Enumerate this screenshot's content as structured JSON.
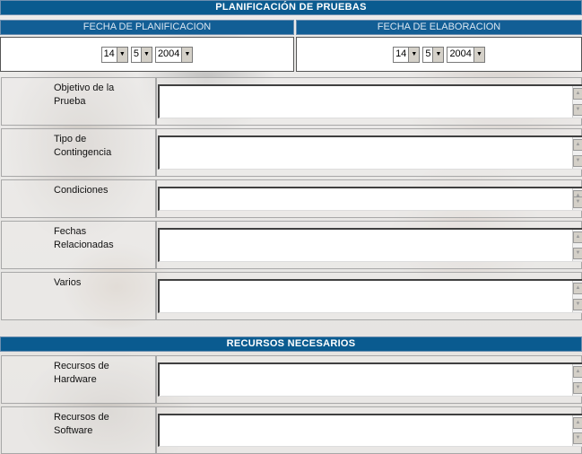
{
  "header": {
    "title": "PLANIFICACIÓN DE PRUEBAS"
  },
  "dates": {
    "planificacion": {
      "label": "FECHA DE PLANIFICACION",
      "day": "14",
      "month": "5",
      "year": "2004"
    },
    "elaboracion": {
      "label": "FECHA DE ELABORACION",
      "day": "14",
      "month": "5",
      "year": "2004"
    }
  },
  "fields": [
    {
      "label": "Objetivo de la\nPrueba",
      "value": ""
    },
    {
      "label": "Tipo de\nContingencia",
      "value": ""
    },
    {
      "label": "Condiciones",
      "value": ""
    },
    {
      "label": "Fechas\nRelacionadas",
      "value": ""
    },
    {
      "label": "Varios",
      "value": ""
    }
  ],
  "recursos": {
    "title": "RECURSOS NECESARIOS",
    "fields": [
      {
        "label": "Recursos de\nHardware",
        "value": ""
      },
      {
        "label": "Recursos de\nSoftware",
        "value": ""
      }
    ]
  },
  "icons": {
    "dropdown_arrow": "triangle-down",
    "scroll_up": "triangle-up",
    "scroll_down": "triangle-down"
  }
}
